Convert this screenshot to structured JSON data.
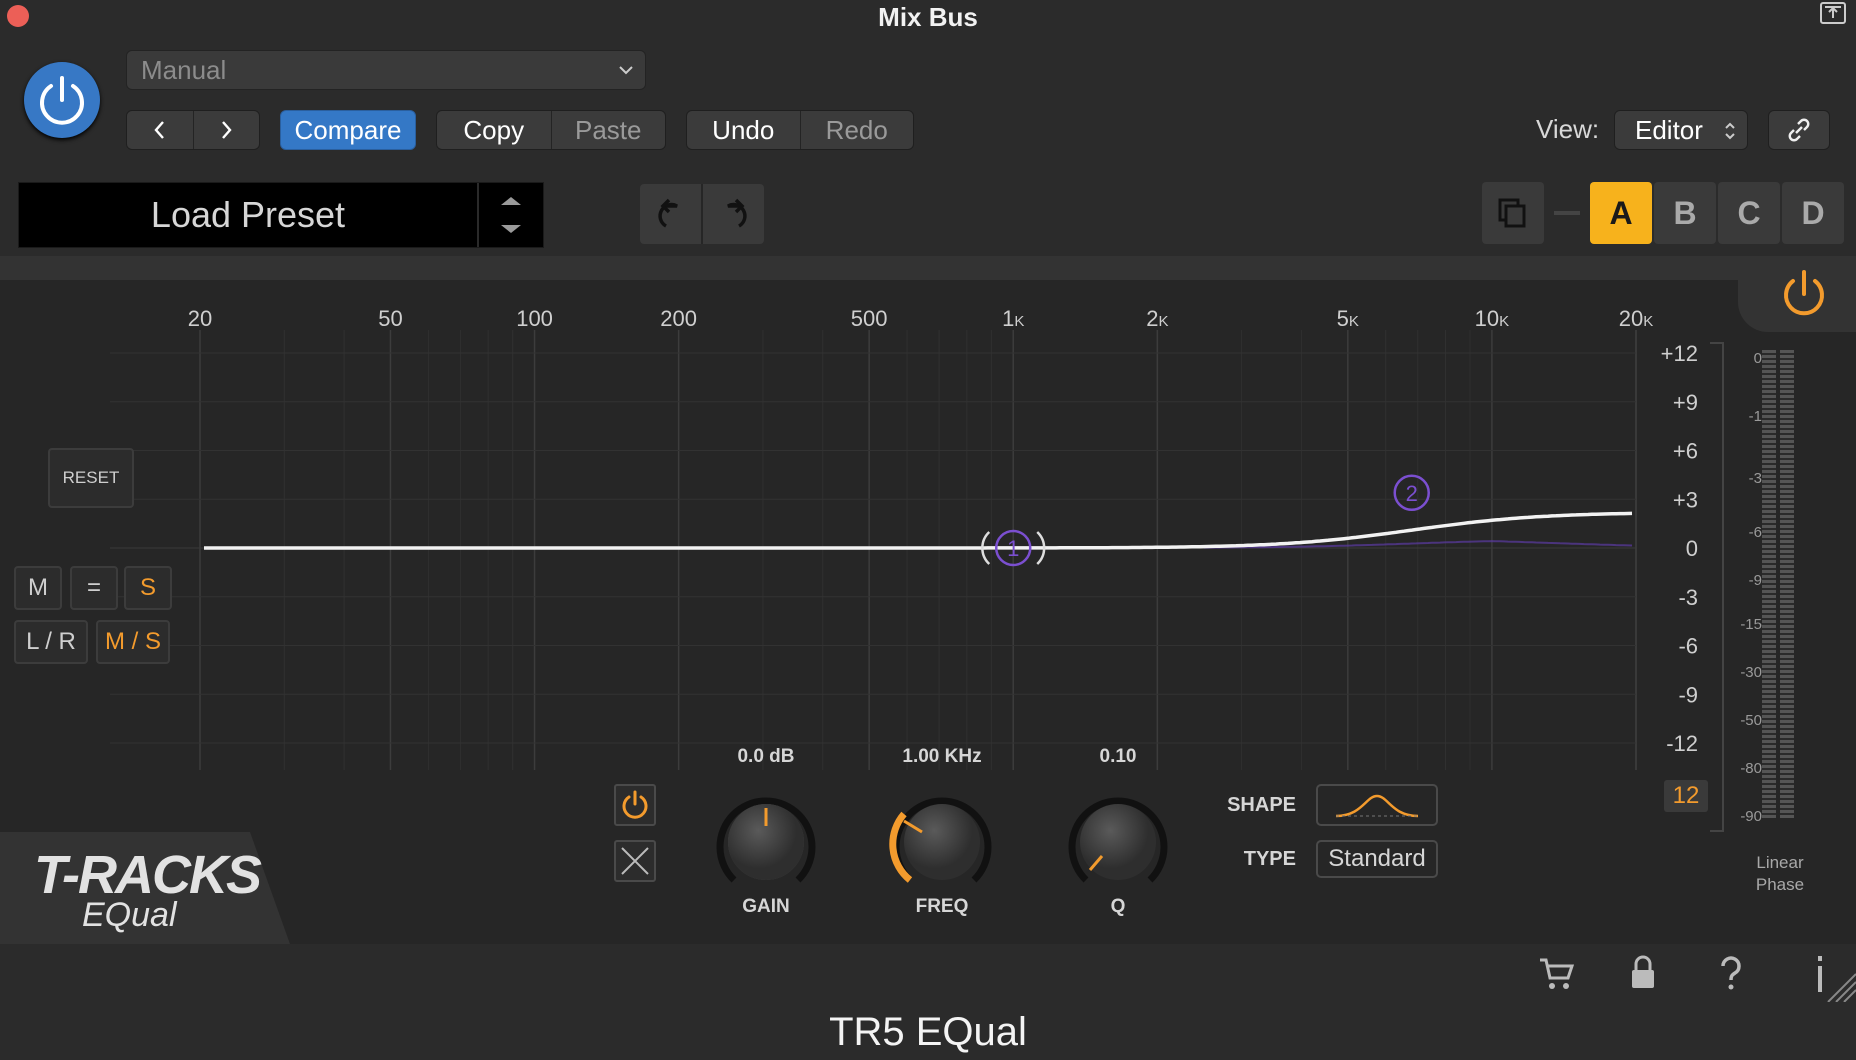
{
  "window": {
    "title": "Mix Bus"
  },
  "host": {
    "preset_value": "Manual",
    "compare": "Compare",
    "copy": "Copy",
    "paste": "Paste",
    "undo": "Undo",
    "redo": "Redo",
    "view_label": "View:",
    "view_value": "Editor"
  },
  "plugin": {
    "load_preset": "Load Preset",
    "ab_slots": [
      "A",
      "B",
      "C",
      "D"
    ],
    "active_slot": "A",
    "reset": "RESET",
    "channel_buttons": [
      "M",
      "=",
      "S"
    ],
    "stereo_buttons": [
      "L / R",
      "M / S"
    ],
    "freq_labels": [
      {
        "text": "20",
        "unit": ""
      },
      {
        "text": "50",
        "unit": ""
      },
      {
        "text": "100",
        "unit": ""
      },
      {
        "text": "200",
        "unit": ""
      },
      {
        "text": "500",
        "unit": ""
      },
      {
        "text": "1",
        "unit": "K"
      },
      {
        "text": "2",
        "unit": "K"
      },
      {
        "text": "5",
        "unit": "K"
      },
      {
        "text": "10",
        "unit": "K"
      },
      {
        "text": "20",
        "unit": "K"
      }
    ],
    "db_labels": [
      "+12",
      "+9",
      "+6",
      "+3",
      "0",
      "-3",
      "-6",
      "-9",
      "-12"
    ],
    "meter_labels": [
      "0",
      "-1",
      "-3",
      "-6",
      "-9",
      "-15",
      "-30",
      "-50",
      "-80",
      "-90"
    ],
    "range_value": "12",
    "bands": [
      {
        "id": "1",
        "freq_hz": 1000,
        "gain_db": 0
      },
      {
        "id": "2",
        "freq_hz": 6800,
        "gain_db": 2.2
      }
    ],
    "gain_value": "0.0 dB",
    "freq_value": "1.00 KHz",
    "q_value": "0.10",
    "gain_label": "GAIN",
    "freq_label": "FREQ",
    "q_label": "Q",
    "shape_label": "SHAPE",
    "type_label": "TYPE",
    "type_value": "Standard",
    "brand_line1": "T-RACKS",
    "brand_line2": "EQual",
    "linear_phase_1": "Linear",
    "linear_phase_2": "Phase",
    "accent": "#f39b2d",
    "band_color": "#7b4fd0"
  },
  "footer": {
    "title": "TR5 EQual"
  }
}
